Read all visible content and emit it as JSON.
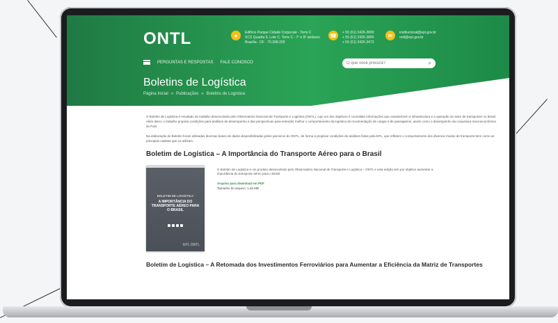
{
  "brand": {
    "logo": "ONTL"
  },
  "header_info": {
    "address": [
      "Edifício Parque Cidade Corporate - Torre C",
      "SCS Quadra 9, Lote C, Torre C - 7º e 8º andares",
      "Brasília - DF - 70.308-200"
    ],
    "phones": [
      "+ 55 (61) 3426-3800",
      "+ 55 (61) 3426-3800",
      "+ 55 (61) 3426-3473"
    ],
    "emails": [
      "institucional@epl.gov.br",
      "ontl@epl.gov.br"
    ]
  },
  "nav": {
    "item1": "PERGUNTAS E RESPOSTAS",
    "item2": "FALE CONOSCO"
  },
  "search": {
    "placeholder": "O que você procura?"
  },
  "page": {
    "title": "Boletins de Logística"
  },
  "breadcrumb": {
    "home": "Página Inicial",
    "pub": "Publicações",
    "current": "Boletins de Logística"
  },
  "intro": {
    "p1": "O Boletim de Logística é resultado do trabalho desenvolvido pelo Observatório Nacional de Transporte e Logística (ONTL), cujo um dos objetivos é consolidar informações que caracterizem a infraestrutura e a operação do setor de transportes no Brasil. Além disso, o trabalho propicia condições para análises de desempenho e das perspectivas para entender melhor o comportamento da logística de movimentação de cargas e de passageiros, assim como o desempenho da conjuntura macroeconômica do País.",
    "p2": "Na elaboração do Boletim foram utilizadas diversas bases de dados disponibilizadas pelos parceiros do ONTL, de forma a propiciar condições de análises feitas pela EPL, que refletem o comportamento dos diversos modos de transporte bem como as principais cadeias que os utilizam."
  },
  "item1": {
    "title": "Boletim de Logística – A Importância do Transporte Aéreo para o Brasil",
    "cover_top": "BOLETIM DE LOGÍSTICA",
    "cover_main": "A IMPORTÂNCIA DO TRANSPORTE AÉREO PARA O BRASIL",
    "cover_bottom": "EPL ONTL",
    "desc": "O Boletim de Logística é um produto desenvolvido pelo Observatório Nacional de Transporte e Logística – ONTL e esta edição tem por objetivo aumentar a importância do transporte aéreo para o Brasil.",
    "link": "Arquivo para download em PDF",
    "size": "Tamanho do arquivo: 1,46 MB"
  },
  "item2": {
    "title": "Boletim de Logística – A Retomada dos Investimentos Ferroviários para Aumentar a Eficiência da Matriz de Transportes"
  }
}
